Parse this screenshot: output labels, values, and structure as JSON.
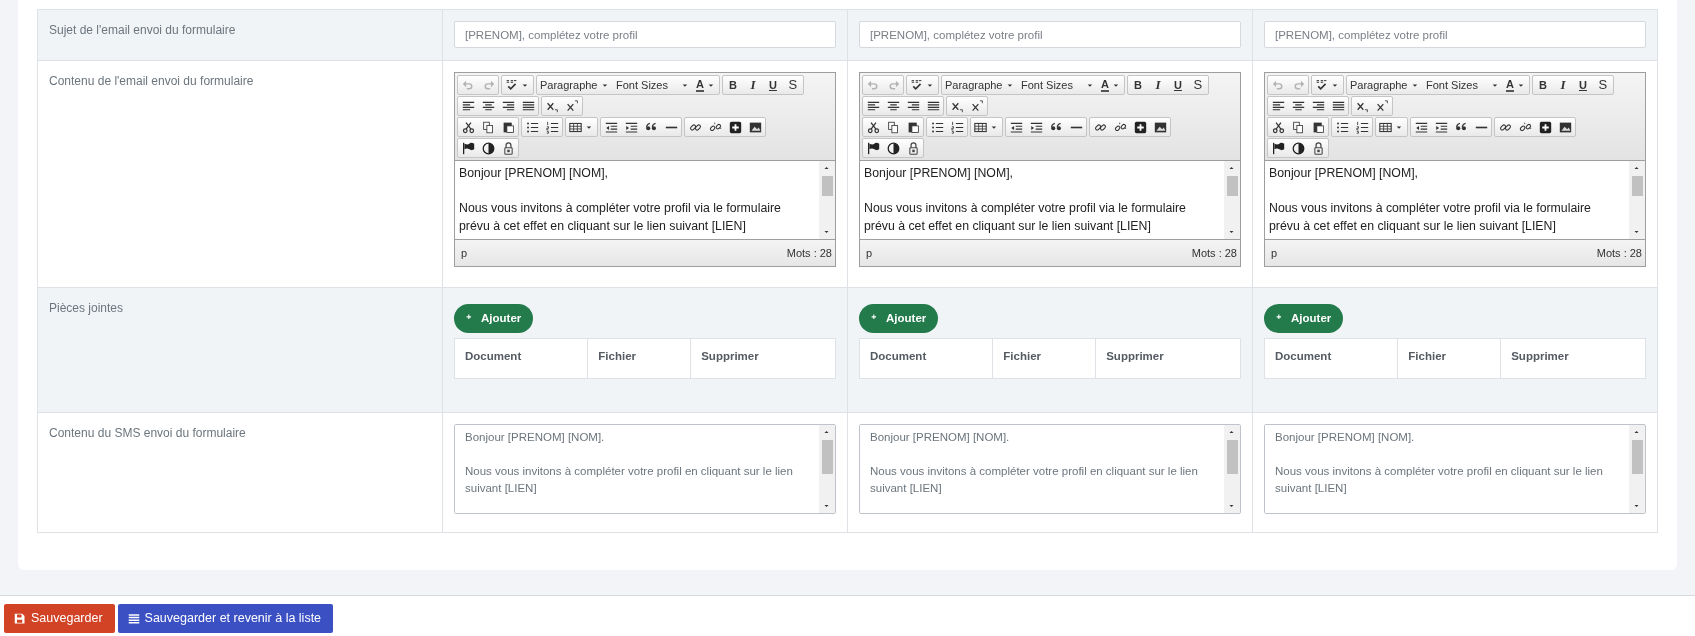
{
  "rows": [
    {
      "kind": "subject",
      "label": "Sujet de l'email envoi du formulaire",
      "shaded": true,
      "cells": [
        {
          "value": "[PRENOM], complétez votre profil"
        },
        {
          "value": "[PRENOM], complétez votre profil"
        },
        {
          "value": "[PRENOM], complétez votre profil"
        }
      ]
    },
    {
      "kind": "editor",
      "label": "Contenu de l'email envoi du formulaire",
      "shaded": false,
      "cells": [
        {
          "history_disabled": true,
          "format": "Paragraphe",
          "font_size": "Font Sizes",
          "text_color": "A",
          "bold": "B",
          "italic": "I",
          "underline": "U",
          "strike": "S",
          "content": "Bonjour [PRENOM] [NOM],\n\nNous vous invitons à compléter votre profil via le formulaire\nprévu à cet effet en cliquant sur le lien suivant [LIEN]",
          "path": "p",
          "word_count": "Mots : 28"
        },
        {
          "history_disabled": true,
          "format": "Paragraphe",
          "font_size": "Font Sizes",
          "text_color": "A",
          "bold": "B",
          "italic": "I",
          "underline": "U",
          "strike": "S",
          "content": "Bonjour [PRENOM] [NOM],\n\nNous vous invitons à compléter votre profil via le formulaire\nprévu à cet effet en cliquant sur le lien suivant [LIEN]",
          "path": "p",
          "word_count": "Mots : 28"
        },
        {
          "history_disabled": true,
          "format": "Paragraphe",
          "font_size": "Font Sizes",
          "text_color": "A",
          "bold": "B",
          "italic": "I",
          "underline": "U",
          "strike": "S",
          "content": "Bonjour [PRENOM] [NOM],\n\nNous vous invitons à compléter votre profil via le formulaire\nprévu à cet effet en cliquant sur le lien suivant [LIEN]",
          "path": "p",
          "word_count": "Mots : 28"
        }
      ]
    },
    {
      "kind": "attachments",
      "label": "Pièces jointes",
      "shaded": true,
      "cells": [
        {
          "button": "Ajouter",
          "columns": [
            "Document",
            "Fichier",
            "Supprimer"
          ]
        },
        {
          "button": "Ajouter",
          "columns": [
            "Document",
            "Fichier",
            "Supprimer"
          ]
        },
        {
          "button": "Ajouter",
          "columns": [
            "Document",
            "Fichier",
            "Supprimer"
          ]
        }
      ]
    },
    {
      "kind": "sms",
      "label": "Contenu du SMS envoi du formulaire",
      "shaded": false,
      "cells": [
        {
          "value": "Bonjour [PRENOM] [NOM].\n\nNous vous invitons à compléter votre profil en cliquant sur le lien suivant [LIEN]"
        },
        {
          "value": "Bonjour [PRENOM] [NOM].\n\nNous vous invitons à compléter votre profil en cliquant sur le lien suivant [LIEN]"
        },
        {
          "value": "Bonjour [PRENOM] [NOM].\n\nNous vous invitons à compléter votre profil en cliquant sur le lien suivant [LIEN]"
        }
      ]
    }
  ],
  "buttons": [
    {
      "kind": "save",
      "label": "Sauvegarder"
    },
    {
      "kind": "save-list",
      "label": "Sauvegarder et revenir à la liste"
    }
  ]
}
